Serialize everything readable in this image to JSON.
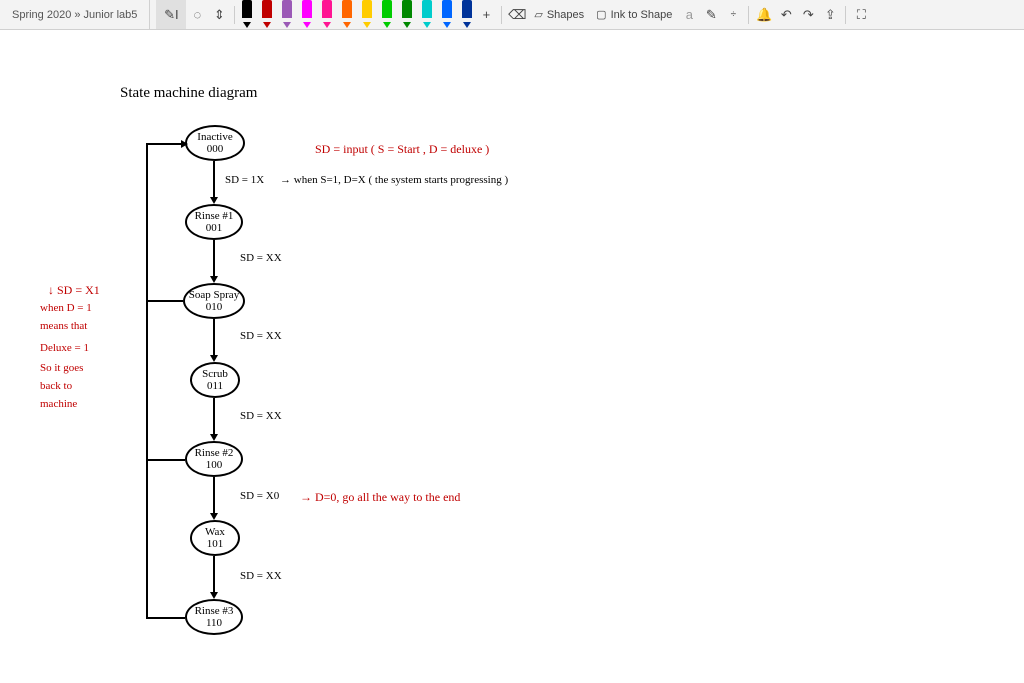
{
  "window": {
    "title": "Spring 2020 » Junior lab5"
  },
  "toolbar": {
    "lasso_label": "Lasso",
    "add_pen_label": "+",
    "eraser_label": "Eraser",
    "shapes_label": "Shapes",
    "ink_to_shape_label": "Ink to Shape",
    "pen_colors": [
      "#000000",
      "#c00000",
      "#9b59b6",
      "#ff00ff",
      "#ff1493",
      "#ff6600",
      "#ffcc00",
      "#00cc00",
      "#008800",
      "#00cccc",
      "#0066ff",
      "#003399"
    ]
  },
  "diagram": {
    "title": "State machine diagram",
    "states": [
      {
        "name": "Inactive",
        "code": "000"
      },
      {
        "name": "Rinse #1",
        "code": "001"
      },
      {
        "name": "Soap Spray",
        "code": "010"
      },
      {
        "name": "Scrub",
        "code": "011"
      },
      {
        "name": "Rinse #2",
        "code": "100"
      },
      {
        "name": "Wax",
        "code": "101"
      },
      {
        "name": "Rinse #3",
        "code": "110"
      }
    ],
    "annotations": {
      "input_legend": "SD = input ( S = Start , D = deluxe )",
      "t01": "SD = 1X",
      "t01_note": "→ when S=1, D=X ( the system starts progressing )",
      "t12": "SD = XX",
      "t23": "SD = XX",
      "t34": "SD = XX",
      "t45": "SD = X0",
      "t45_note": "→ D=0, go all the way to the end",
      "t56": "SD = XX",
      "left_cond": "↓ SD = X1",
      "left_note1": "when D = 1",
      "left_note2": "means that",
      "left_note3": "Deluxe = 1",
      "left_note4": "So it goes",
      "left_note5": "back to",
      "left_note6": "machine"
    }
  }
}
